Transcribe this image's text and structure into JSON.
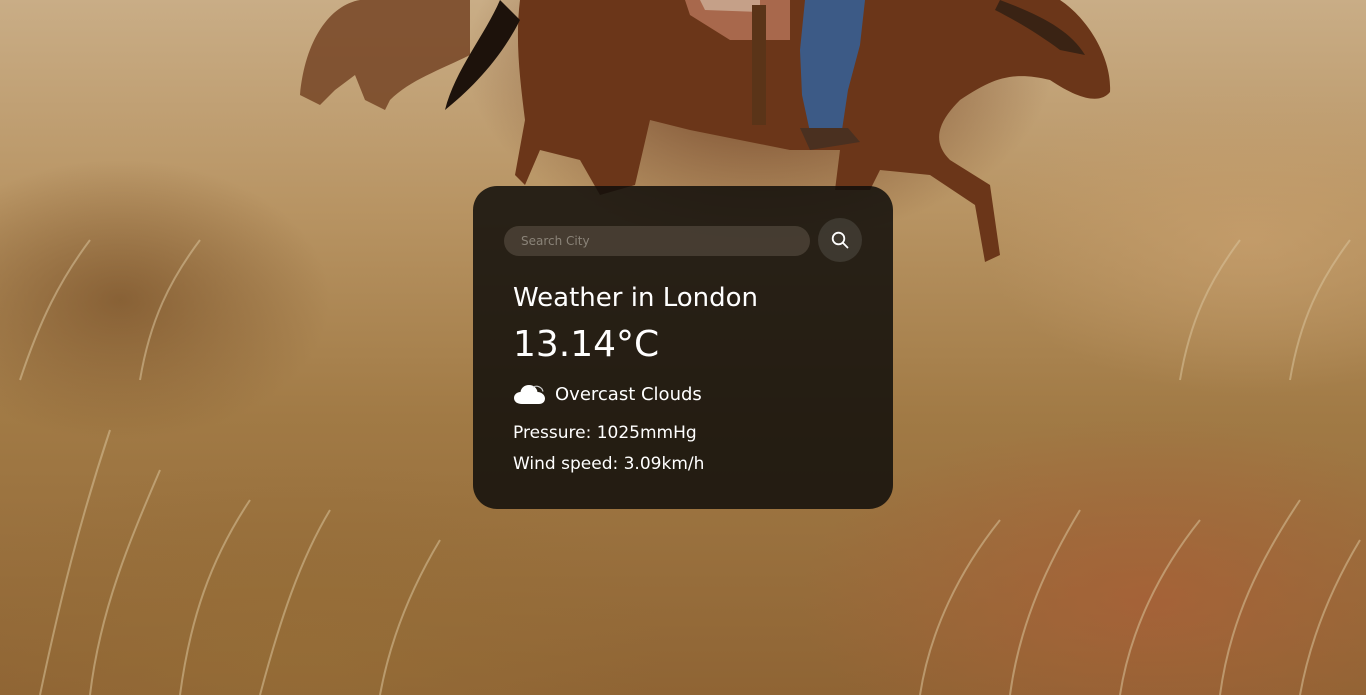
{
  "search": {
    "placeholder": "Search City",
    "value": "",
    "button_icon": "search-icon"
  },
  "weather": {
    "title": "Weather in London",
    "temperature": "13.14°C",
    "condition": "Overcast Clouds",
    "condition_icon": "cloud-icon",
    "pressure": "Pressure: 1025mmHg",
    "wind_speed": "Wind speed: 3.09km/h"
  },
  "background": {
    "subject_icon": "horse-rider-photo"
  },
  "colors": {
    "card_background": "#100e0b",
    "text": "#ffffff"
  }
}
